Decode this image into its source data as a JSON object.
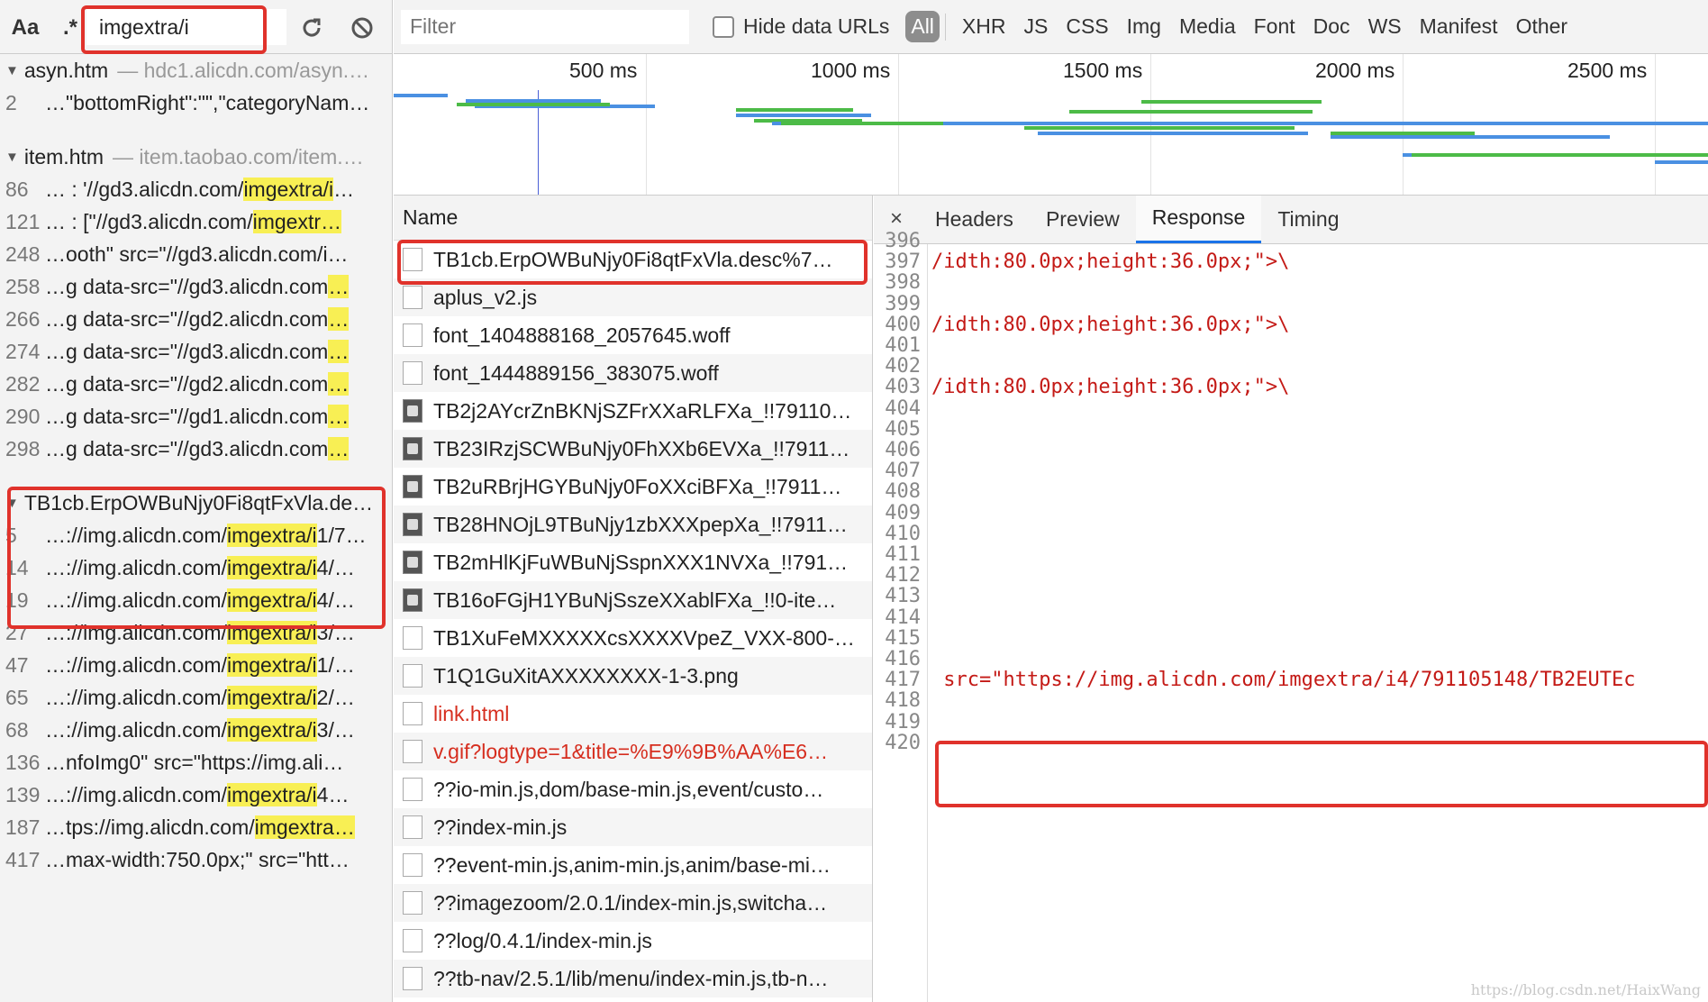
{
  "search": {
    "case_label": "Aa",
    "regex_label": ".*",
    "query": "imgextra/i"
  },
  "results": {
    "groups": [
      {
        "title": "asyn.htm",
        "url": "— hdc1.alicdn.com/asyn.…",
        "rows": [
          {
            "line": "2",
            "pre": "…\"bottomRight\":\"\",\"categoryNam…",
            "hl": "",
            "post": ""
          }
        ]
      },
      {
        "title": "item.htm",
        "url": "— item.taobao.com/item.…",
        "rows": [
          {
            "line": "86",
            "pre": "… : '//gd3.alicdn.com/",
            "hl": "imgextra/i",
            "post": "…"
          },
          {
            "line": "121",
            "pre": "… : [\"//gd3.alicdn.com/",
            "hl": "imgextr…",
            "post": ""
          },
          {
            "line": "248",
            "pre": "…ooth\" src=\"//gd3.alicdn.com/i…",
            "hl": "",
            "post": ""
          },
          {
            "line": "258",
            "pre": "…g data-src=\"//gd3.alicdn.com",
            "hl": "…",
            "post": ""
          },
          {
            "line": "266",
            "pre": "…g data-src=\"//gd2.alicdn.com",
            "hl": "…",
            "post": ""
          },
          {
            "line": "274",
            "pre": "…g data-src=\"//gd3.alicdn.com",
            "hl": "…",
            "post": ""
          },
          {
            "line": "282",
            "pre": "…g data-src=\"//gd2.alicdn.com",
            "hl": "…",
            "post": ""
          },
          {
            "line": "290",
            "pre": "…g data-src=\"//gd1.alicdn.com",
            "hl": "…",
            "post": ""
          },
          {
            "line": "298",
            "pre": "…g data-src=\"//gd3.alicdn.com",
            "hl": "…",
            "post": ""
          }
        ]
      },
      {
        "title": "TB1cb.ErpOWBuNjy0Fi8qtFxVla.de…",
        "url": "",
        "rows": [
          {
            "line": "5",
            "pre": "…://img.alicdn.com/",
            "hl": "imgextra/i",
            "post": "1/7…"
          },
          {
            "line": "14",
            "pre": "…://img.alicdn.com/",
            "hl": "imgextra/i",
            "post": "4/…"
          },
          {
            "line": "19",
            "pre": "…://img.alicdn.com/",
            "hl": "imgextra/i",
            "post": "4/…"
          },
          {
            "line": "27",
            "pre": "…://img.alicdn.com/",
            "hl": "imgextra/i",
            "post": "3/…"
          },
          {
            "line": "47",
            "pre": "…://img.alicdn.com/",
            "hl": "imgextra/i",
            "post": "1/…"
          },
          {
            "line": "65",
            "pre": "…://img.alicdn.com/",
            "hl": "imgextra/i",
            "post": "2/…"
          },
          {
            "line": "68",
            "pre": "…://img.alicdn.com/",
            "hl": "imgextra/i",
            "post": "3/…"
          },
          {
            "line": "136",
            "pre": "…nfoImg0\" src=\"https://img.ali…",
            "hl": "",
            "post": ""
          },
          {
            "line": "139",
            "pre": "…://img.alicdn.com/",
            "hl": "imgextra/i",
            "post": "4…"
          },
          {
            "line": "187",
            "pre": "…tps://img.alicdn.com/",
            "hl": "imgextra…",
            "post": ""
          },
          {
            "line": "417",
            "pre": "…max-width:750.0px;\" src=\"htt…",
            "hl": "",
            "post": ""
          }
        ]
      }
    ]
  },
  "filter": {
    "placeholder": "Filter",
    "hide_data_urls": "Hide data URLs",
    "types": [
      "All",
      "XHR",
      "JS",
      "CSS",
      "Img",
      "Media",
      "Font",
      "Doc",
      "WS",
      "Manifest",
      "Other"
    ]
  },
  "timeline": {
    "labels": [
      "500 ms",
      "1000 ms",
      "1500 ms",
      "2000 ms",
      "2500 ms"
    ]
  },
  "network": {
    "header": "Name",
    "requests": [
      {
        "name": "TB1cb.ErpOWBuNjy0Fi8qtFxVla.desc%7…",
        "icon": "doc",
        "red": false
      },
      {
        "name": "aplus_v2.js",
        "icon": "doc",
        "red": false
      },
      {
        "name": "font_1404888168_2057645.woff",
        "icon": "doc",
        "red": false
      },
      {
        "name": "font_1444889156_383075.woff",
        "icon": "doc",
        "red": false
      },
      {
        "name": "TB2j2AYcrZnBKNjSZFrXXaRLFXa_!!79110…",
        "icon": "img",
        "red": false
      },
      {
        "name": "TB23IRzjSCWBuNjy0FhXXb6EVXa_!!7911…",
        "icon": "img",
        "red": false
      },
      {
        "name": "TB2uRBrjHGYBuNjy0FoXXciBFXa_!!7911…",
        "icon": "img",
        "red": false
      },
      {
        "name": "TB28HNOjL9TBuNjy1zbXXXpepXa_!!7911…",
        "icon": "img",
        "red": false
      },
      {
        "name": "TB2mHlKjFuWBuNjSspnXXX1NVXa_!!791…",
        "icon": "img",
        "red": false
      },
      {
        "name": "TB16oFGjH1YBuNjSszeXXablFXa_!!0-ite…",
        "icon": "img",
        "red": false
      },
      {
        "name": "TB1XuFeMXXXXXcsXXXXVpeZ_VXX-800-…",
        "icon": "doc",
        "red": false
      },
      {
        "name": "T1Q1GuXitAXXXXXXXX-1-3.png",
        "icon": "doc",
        "red": false
      },
      {
        "name": "link.html",
        "icon": "doc",
        "red": true
      },
      {
        "name": "v.gif?logtype=1&title=%E9%9B%AA%E6…",
        "icon": "doc",
        "red": true
      },
      {
        "name": "??io-min.js,dom/base-min.js,event/custo…",
        "icon": "doc",
        "red": false
      },
      {
        "name": "??index-min.js",
        "icon": "doc",
        "red": false
      },
      {
        "name": "??event-min.js,anim-min.js,anim/base-mi…",
        "icon": "doc",
        "red": false
      },
      {
        "name": "??imagezoom/2.0.1/index-min.js,switcha…",
        "icon": "doc",
        "red": false
      },
      {
        "name": "??log/0.4.1/index-min.js",
        "icon": "doc",
        "red": false
      },
      {
        "name": "??tb-nav/2.5.1/lib/menu/index-min.js,tb-n…",
        "icon": "doc",
        "red": false
      }
    ]
  },
  "detail": {
    "close": "×",
    "tabs": [
      "Headers",
      "Preview",
      "Response",
      "Timing"
    ],
    "active_tab": "Response",
    "lines": [
      {
        "n": "396",
        "t": ""
      },
      {
        "n": "397",
        "t": "/idth:80.0px;height:36.0px;\">\\"
      },
      {
        "n": "398",
        "t": ""
      },
      {
        "n": "399",
        "t": ""
      },
      {
        "n": "400",
        "t": "/idth:80.0px;height:36.0px;\">\\"
      },
      {
        "n": "401",
        "t": ""
      },
      {
        "n": "402",
        "t": ""
      },
      {
        "n": "403",
        "t": "/idth:80.0px;height:36.0px;\">\\"
      },
      {
        "n": "404",
        "t": ""
      },
      {
        "n": "405",
        "t": ""
      },
      {
        "n": "406",
        "t": ""
      },
      {
        "n": "407",
        "t": ""
      },
      {
        "n": "408",
        "t": ""
      },
      {
        "n": "409",
        "t": ""
      },
      {
        "n": "410",
        "t": ""
      },
      {
        "n": "411",
        "t": ""
      },
      {
        "n": "412",
        "t": ""
      },
      {
        "n": "413",
        "t": ""
      },
      {
        "n": "414",
        "t": ""
      },
      {
        "n": "415",
        "t": ""
      },
      {
        "n": "416",
        "t": ""
      },
      {
        "n": "417",
        "t": " src=\"https://img.alicdn.com/imgextra/i4/791105148/TB2EUTEc"
      },
      {
        "n": "418",
        "t": ""
      },
      {
        "n": "419",
        "t": ""
      },
      {
        "n": "420",
        "t": ""
      }
    ]
  },
  "watermark": "https://blog.csdn.net/HaixWang",
  "colors": {
    "highlight": "#f8ef54",
    "annotation": "#e0322b",
    "code": "#c41a16",
    "waterfall_blue": "#4a90e2",
    "waterfall_green": "#4cbb47"
  }
}
